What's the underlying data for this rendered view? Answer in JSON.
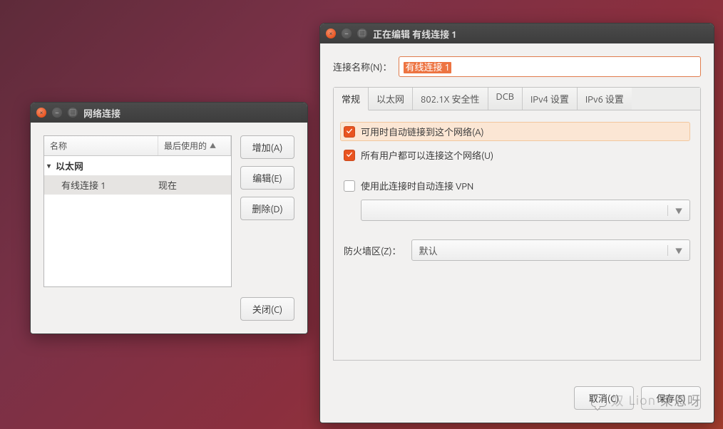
{
  "win1": {
    "title": "网络连接",
    "columns": {
      "name": "名称",
      "last_used": "最后使用的"
    },
    "group": "以太网",
    "item": {
      "name": "有线连接 1",
      "last": "现在"
    },
    "buttons": {
      "add": "增加(A)",
      "edit": "编辑(E)",
      "delete": "删除(D)",
      "close": "关闭(C)"
    }
  },
  "win2": {
    "title": "正在编辑 有线连接 1",
    "name_label": "连接名称(N)：",
    "name_value": "有线连接 1",
    "tabs": {
      "general": "常规",
      "ethernet": "以太网",
      "security": "802.1X 安全性",
      "dcb": "DCB",
      "ipv4": "IPv4 设置",
      "ipv6": "IPv6 设置"
    },
    "checks": {
      "auto_connect": "可用时自动链接到这个网络(A)",
      "all_users": "所有用户都可以连接这个网络(U)",
      "auto_vpn": "使用此连接时自动连接 VPN"
    },
    "vpn_combo": "",
    "firewall_label": "防火墙区(Z)：",
    "firewall_value": "默认",
    "buttons": {
      "cancel": "取消(C)",
      "save": "保存(S)"
    }
  },
  "watermark": "莱恩呀"
}
